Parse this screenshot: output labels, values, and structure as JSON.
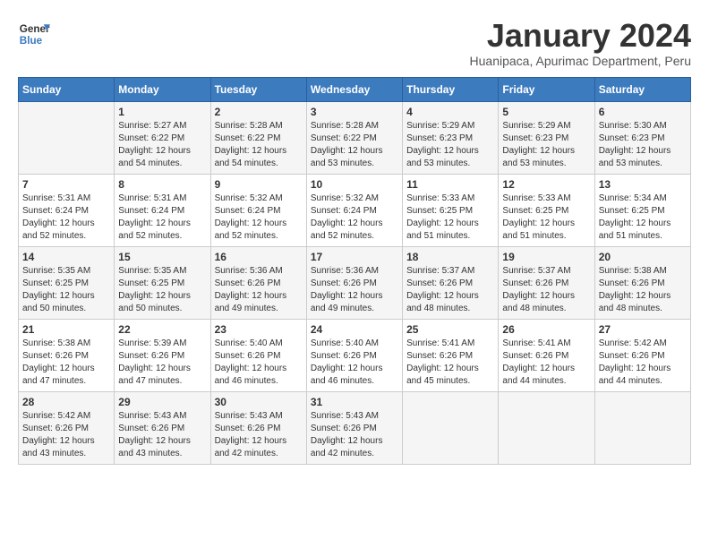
{
  "header": {
    "logo_line1": "General",
    "logo_line2": "Blue",
    "month": "January 2024",
    "location": "Huanipaca, Apurimac Department, Peru"
  },
  "days_of_week": [
    "Sunday",
    "Monday",
    "Tuesday",
    "Wednesday",
    "Thursday",
    "Friday",
    "Saturday"
  ],
  "weeks": [
    [
      {
        "day": "",
        "info": ""
      },
      {
        "day": "1",
        "info": "Sunrise: 5:27 AM\nSunset: 6:22 PM\nDaylight: 12 hours\nand 54 minutes."
      },
      {
        "day": "2",
        "info": "Sunrise: 5:28 AM\nSunset: 6:22 PM\nDaylight: 12 hours\nand 54 minutes."
      },
      {
        "day": "3",
        "info": "Sunrise: 5:28 AM\nSunset: 6:22 PM\nDaylight: 12 hours\nand 53 minutes."
      },
      {
        "day": "4",
        "info": "Sunrise: 5:29 AM\nSunset: 6:23 PM\nDaylight: 12 hours\nand 53 minutes."
      },
      {
        "day": "5",
        "info": "Sunrise: 5:29 AM\nSunset: 6:23 PM\nDaylight: 12 hours\nand 53 minutes."
      },
      {
        "day": "6",
        "info": "Sunrise: 5:30 AM\nSunset: 6:23 PM\nDaylight: 12 hours\nand 53 minutes."
      }
    ],
    [
      {
        "day": "7",
        "info": "Sunrise: 5:31 AM\nSunset: 6:24 PM\nDaylight: 12 hours\nand 52 minutes."
      },
      {
        "day": "8",
        "info": "Sunrise: 5:31 AM\nSunset: 6:24 PM\nDaylight: 12 hours\nand 52 minutes."
      },
      {
        "day": "9",
        "info": "Sunrise: 5:32 AM\nSunset: 6:24 PM\nDaylight: 12 hours\nand 52 minutes."
      },
      {
        "day": "10",
        "info": "Sunrise: 5:32 AM\nSunset: 6:24 PM\nDaylight: 12 hours\nand 52 minutes."
      },
      {
        "day": "11",
        "info": "Sunrise: 5:33 AM\nSunset: 6:25 PM\nDaylight: 12 hours\nand 51 minutes."
      },
      {
        "day": "12",
        "info": "Sunrise: 5:33 AM\nSunset: 6:25 PM\nDaylight: 12 hours\nand 51 minutes."
      },
      {
        "day": "13",
        "info": "Sunrise: 5:34 AM\nSunset: 6:25 PM\nDaylight: 12 hours\nand 51 minutes."
      }
    ],
    [
      {
        "day": "14",
        "info": "Sunrise: 5:35 AM\nSunset: 6:25 PM\nDaylight: 12 hours\nand 50 minutes."
      },
      {
        "day": "15",
        "info": "Sunrise: 5:35 AM\nSunset: 6:25 PM\nDaylight: 12 hours\nand 50 minutes."
      },
      {
        "day": "16",
        "info": "Sunrise: 5:36 AM\nSunset: 6:26 PM\nDaylight: 12 hours\nand 49 minutes."
      },
      {
        "day": "17",
        "info": "Sunrise: 5:36 AM\nSunset: 6:26 PM\nDaylight: 12 hours\nand 49 minutes."
      },
      {
        "day": "18",
        "info": "Sunrise: 5:37 AM\nSunset: 6:26 PM\nDaylight: 12 hours\nand 48 minutes."
      },
      {
        "day": "19",
        "info": "Sunrise: 5:37 AM\nSunset: 6:26 PM\nDaylight: 12 hours\nand 48 minutes."
      },
      {
        "day": "20",
        "info": "Sunrise: 5:38 AM\nSunset: 6:26 PM\nDaylight: 12 hours\nand 48 minutes."
      }
    ],
    [
      {
        "day": "21",
        "info": "Sunrise: 5:38 AM\nSunset: 6:26 PM\nDaylight: 12 hours\nand 47 minutes."
      },
      {
        "day": "22",
        "info": "Sunrise: 5:39 AM\nSunset: 6:26 PM\nDaylight: 12 hours\nand 47 minutes."
      },
      {
        "day": "23",
        "info": "Sunrise: 5:40 AM\nSunset: 6:26 PM\nDaylight: 12 hours\nand 46 minutes."
      },
      {
        "day": "24",
        "info": "Sunrise: 5:40 AM\nSunset: 6:26 PM\nDaylight: 12 hours\nand 46 minutes."
      },
      {
        "day": "25",
        "info": "Sunrise: 5:41 AM\nSunset: 6:26 PM\nDaylight: 12 hours\nand 45 minutes."
      },
      {
        "day": "26",
        "info": "Sunrise: 5:41 AM\nSunset: 6:26 PM\nDaylight: 12 hours\nand 44 minutes."
      },
      {
        "day": "27",
        "info": "Sunrise: 5:42 AM\nSunset: 6:26 PM\nDaylight: 12 hours\nand 44 minutes."
      }
    ],
    [
      {
        "day": "28",
        "info": "Sunrise: 5:42 AM\nSunset: 6:26 PM\nDaylight: 12 hours\nand 43 minutes."
      },
      {
        "day": "29",
        "info": "Sunrise: 5:43 AM\nSunset: 6:26 PM\nDaylight: 12 hours\nand 43 minutes."
      },
      {
        "day": "30",
        "info": "Sunrise: 5:43 AM\nSunset: 6:26 PM\nDaylight: 12 hours\nand 42 minutes."
      },
      {
        "day": "31",
        "info": "Sunrise: 5:43 AM\nSunset: 6:26 PM\nDaylight: 12 hours\nand 42 minutes."
      },
      {
        "day": "",
        "info": ""
      },
      {
        "day": "",
        "info": ""
      },
      {
        "day": "",
        "info": ""
      }
    ]
  ]
}
